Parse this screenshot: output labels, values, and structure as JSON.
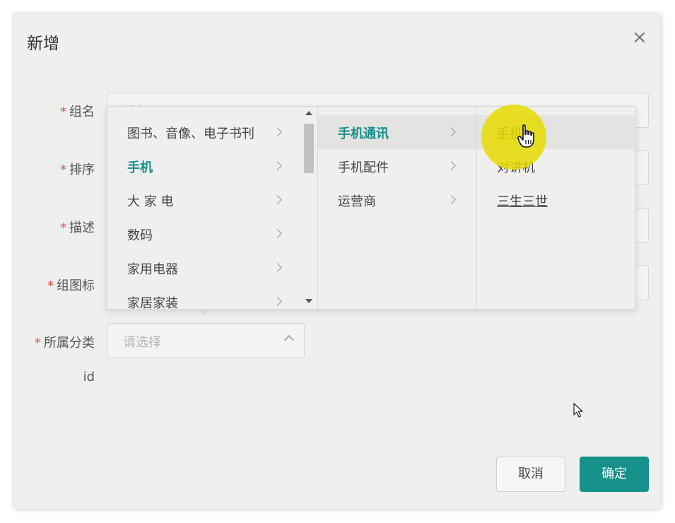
{
  "dialog": {
    "title": "新增",
    "close_glyph": "×"
  },
  "form": {
    "fields": [
      {
        "label": "组名",
        "required": true,
        "placeholder": "组名"
      },
      {
        "label": "排序",
        "required": true
      },
      {
        "label": "描述",
        "required": true
      },
      {
        "label": "组图标",
        "required": true
      },
      {
        "label": "所属分类",
        "required": true,
        "placeholder": "请选择"
      },
      {
        "label": "id",
        "required": false
      }
    ],
    "required_mark": "*"
  },
  "cascader": {
    "col1": [
      {
        "label": "图书、音像、电子书刊"
      },
      {
        "label": "手机",
        "active": true
      },
      {
        "label": "大 家 电"
      },
      {
        "label": "数码"
      },
      {
        "label": "家用电器"
      },
      {
        "label": "家居家装"
      }
    ],
    "col2": [
      {
        "label": "手机通讯",
        "active": true
      },
      {
        "label": "手机配件"
      },
      {
        "label": "运营商"
      }
    ],
    "col3": [
      {
        "label": "手机",
        "hover": true
      },
      {
        "label": "对讲机"
      },
      {
        "label": "三生三世"
      }
    ]
  },
  "buttons": {
    "cancel": "取消",
    "ok": "确定"
  },
  "colors": {
    "accent": "#16908b",
    "required": "#e5534b",
    "cursor_highlight": "#e6dc00"
  },
  "icons": [
    "close-icon",
    "chevron-right-icon",
    "chevron-up-icon",
    "hand-cursor-icon",
    "pointer-cursor-icon"
  ]
}
